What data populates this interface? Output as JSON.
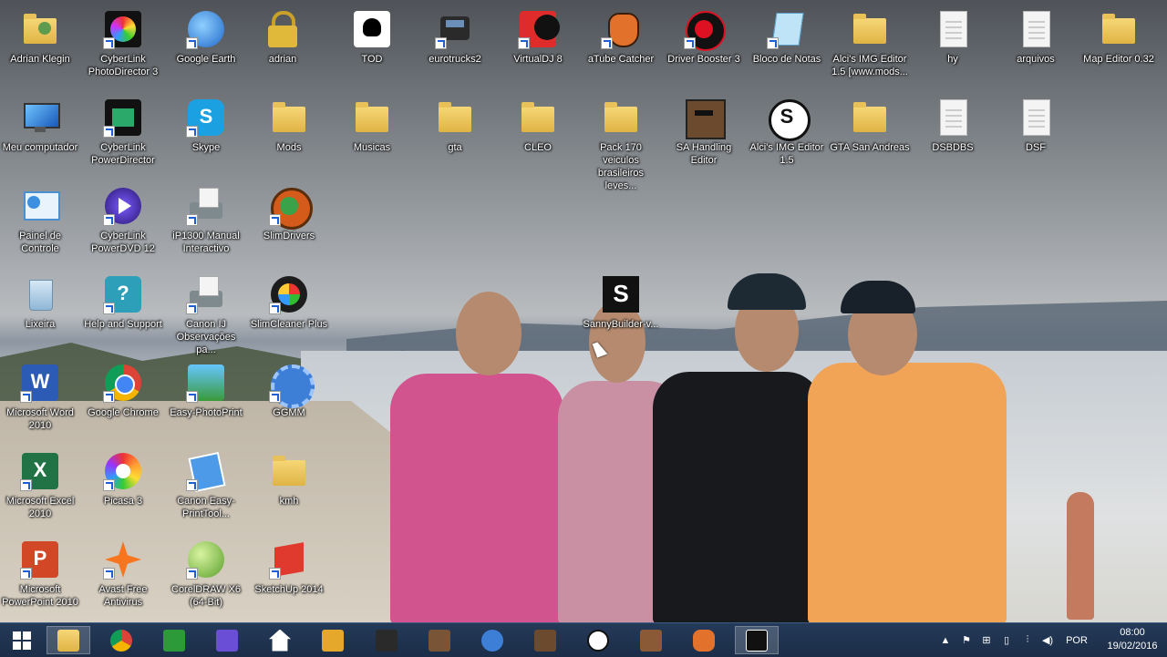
{
  "desktop": {
    "icons": [
      {
        "label": "Adrian Klegin"
      },
      {
        "label": "CyberLink PhotoDirector 3"
      },
      {
        "label": "Google Earth"
      },
      {
        "label": "adrian"
      },
      {
        "label": "TOD"
      },
      {
        "label": "eurotrucks2"
      },
      {
        "label": "VirtualDJ 8"
      },
      {
        "label": "aTube Catcher"
      },
      {
        "label": "Driver Booster 3"
      },
      {
        "label": "Bloco de Notas"
      },
      {
        "label": "Alci's IMG Editor 1.5 [www.mods..."
      },
      {
        "label": "hy"
      },
      {
        "label": "arquivos"
      },
      {
        "label": "Map Editor 0.32"
      },
      {
        "label": "Meu computador"
      },
      {
        "label": "CyberLink PowerDirector"
      },
      {
        "label": "Skype"
      },
      {
        "label": "Mods"
      },
      {
        "label": "Musicas"
      },
      {
        "label": "gta"
      },
      {
        "label": "CLEO"
      },
      {
        "label": "Pack 170 veiculos brasileiros leves..."
      },
      {
        "label": "SA Handling Editor"
      },
      {
        "label": "Alci's IMG Editor 1.5"
      },
      {
        "label": "GTA San Andreas"
      },
      {
        "label": "DSBDBS"
      },
      {
        "label": "DSF"
      },
      {
        "label": "Painel de Controle"
      },
      {
        "label": "CyberLink PowerDVD 12"
      },
      {
        "label": "iP1300 Manual Interactivo"
      },
      {
        "label": "SlimDrivers"
      },
      {
        "label": "Lixeira"
      },
      {
        "label": "Help and Support"
      },
      {
        "label": "Canon IJ Observações pa..."
      },
      {
        "label": "SlimCleaner Plus"
      },
      {
        "label": "SannyBuilder-v..."
      },
      {
        "label": "Microsoft Word 2010"
      },
      {
        "label": "Google Chrome"
      },
      {
        "label": "Easy-PhotoPrint"
      },
      {
        "label": "GGMM"
      },
      {
        "label": "Microsoft Excel 2010"
      },
      {
        "label": "Picasa 3"
      },
      {
        "label": "Canon Easy-PrintTool..."
      },
      {
        "label": "kmh"
      },
      {
        "label": "Microsoft PowerPoint 2010"
      },
      {
        "label": "Avast Free Antivirus"
      },
      {
        "label": "CorelDRAW X6 (64-Bit)"
      },
      {
        "label": "SketchUp 2014"
      }
    ]
  },
  "taskbar": {
    "clock_time": "08:00",
    "clock_date": "19/02/2016",
    "language": "POR"
  }
}
